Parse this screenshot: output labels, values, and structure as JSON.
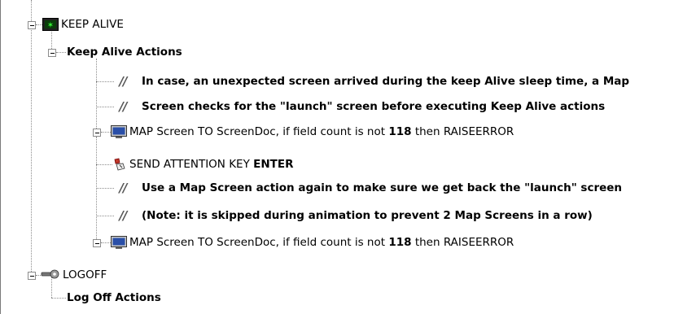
{
  "tree": {
    "keep_alive": {
      "icon": "terminal-green-icon",
      "label": "KEEP ALIVE"
    },
    "keep_alive_actions": {
      "label": "Keep Alive Actions"
    },
    "comment1": {
      "icon": "comment-slashes-icon",
      "marker": "//",
      "text": "In case, an unexpected screen arrived during the keep Alive sleep time, a Map"
    },
    "comment2": {
      "icon": "comment-slashes-icon",
      "marker": "//",
      "text": "Screen checks for the \"launch\" screen before executing Keep Alive actions"
    },
    "map1": {
      "icon": "monitor-icon",
      "prefix": "MAP Screen TO ScreenDoc, if field count is not",
      "count": "118",
      "suffix": "then RAISEERROR"
    },
    "send_key": {
      "icon": "key-press-icon",
      "prefix": "SEND ATTENTION KEY",
      "key": "ENTER"
    },
    "comment3": {
      "icon": "comment-slashes-icon",
      "marker": "//",
      "text": "Use a Map Screen action again to make sure we get back the \"launch\" screen"
    },
    "comment4": {
      "icon": "comment-slashes-icon",
      "marker": "//",
      "text": "(Note: it is skipped during animation to prevent 2 Map Screens in a row)"
    },
    "map2": {
      "icon": "monitor-icon",
      "prefix": "MAP Screen TO ScreenDoc, if field count is not",
      "count": "118",
      "suffix": "then RAISEERROR"
    },
    "logoff": {
      "icon": "logoff-key-icon",
      "label": "LOGOFF"
    },
    "logoff_actions": {
      "label": "Log Off Actions"
    }
  },
  "colors": {
    "terminal": "#1a8a1a",
    "monitor": "#2a4fa8",
    "tree_lines": "#8c8c8c"
  }
}
